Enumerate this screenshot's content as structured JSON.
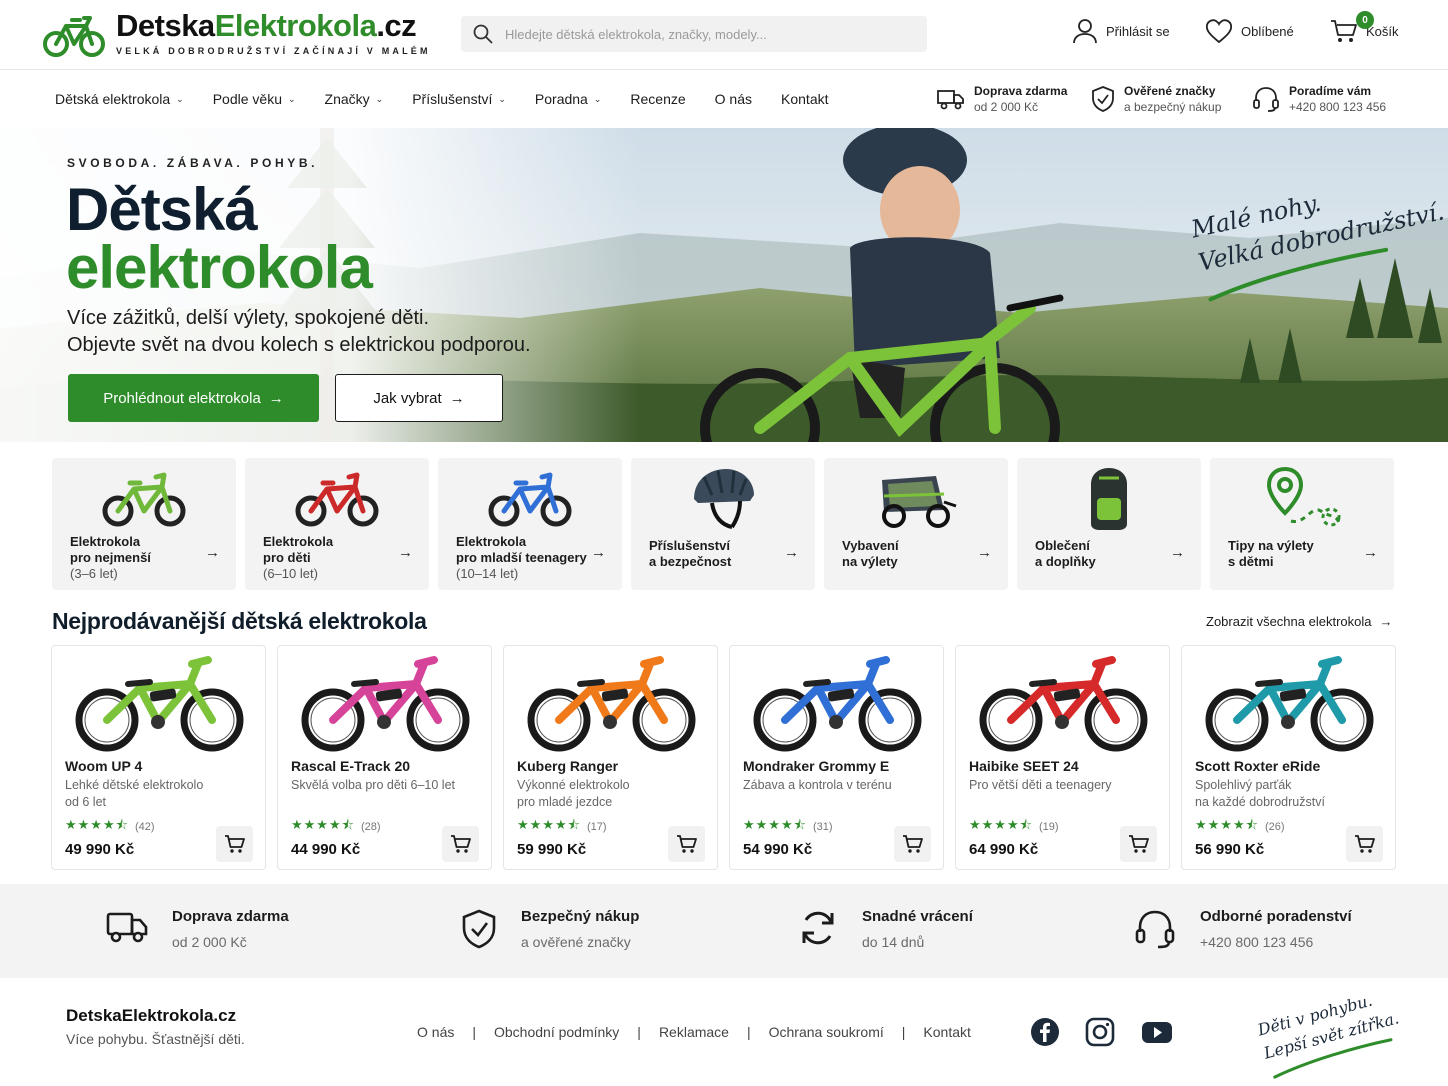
{
  "header": {
    "brand_part1": "Detska",
    "brand_part2": "Elektrokola",
    "brand_part3": ".cz",
    "tagline": "VELKÁ DOBRODRUŽSTVÍ ZAČÍNAJÍ V MALÉM",
    "search_placeholder": "Hledejte dětská elektrokola, značky, modely...",
    "login": "Přihlásit se",
    "favorites": "Oblíbené",
    "cart": "Košík",
    "cart_count": "0"
  },
  "nav": {
    "items": [
      {
        "label": "Dětská elektrokola",
        "dropdown": true
      },
      {
        "label": "Podle věku",
        "dropdown": true
      },
      {
        "label": "Značky",
        "dropdown": true
      },
      {
        "label": "Příslušenství",
        "dropdown": true
      },
      {
        "label": "Poradna",
        "dropdown": true
      },
      {
        "label": "Recenze",
        "dropdown": false
      },
      {
        "label": "O nás",
        "dropdown": false
      },
      {
        "label": "Kontakt",
        "dropdown": false
      }
    ],
    "usps": [
      {
        "title": "Doprava zdarma",
        "text": "od 2 000 Kč",
        "icon": "truck-icon"
      },
      {
        "title": "Ověřené značky",
        "text": "a bezpečný nákup",
        "icon": "shield-check-icon"
      },
      {
        "title": "Poradíme vám",
        "text": "+420 800 123 456",
        "icon": "headset-icon"
      }
    ]
  },
  "hero": {
    "eyebrow": "SVOBODA. ZÁBAVA. POHYB.",
    "title_line1": "Dětská",
    "title_line2": "elektrokola",
    "subtitle_line1": "Více zážitků, delší výlety, spokojené děti.",
    "subtitle_line2": "Objevte svět na dvou kolech s elektrickou podporou.",
    "cta_primary": "Prohlédnout elektrokola",
    "cta_secondary": "Jak vybrat",
    "script_line1": "Malé nohy.",
    "script_line2": "Velká dobrodružství."
  },
  "categories": [
    {
      "line1": "Elektrokola",
      "line2": "pro nejmenší",
      "line3": "(3–6 let)",
      "icon": "bike-green"
    },
    {
      "line1": "Elektrokola",
      "line2": "pro děti",
      "line3": "(6–10 let)",
      "icon": "bike-red"
    },
    {
      "line1": "Elektrokola",
      "line2": "pro mladší teenagery",
      "line3": "(10–14 let)",
      "icon": "bike-blue"
    },
    {
      "line1": "Příslušenství",
      "line2": "a bezpečnost",
      "line3": "",
      "icon": "helmet"
    },
    {
      "line1": "Vybavení",
      "line2": "na výlety",
      "line3": "",
      "icon": "trailer"
    },
    {
      "line1": "Oblečení",
      "line2": "a doplňky",
      "line3": "",
      "icon": "backpack"
    },
    {
      "line1": "Tipy na výlety",
      "line2": "s dětmi",
      "line3": "",
      "icon": "map-pin"
    }
  ],
  "bestsellers": {
    "title": "Nejprodávanější dětská elektrokola",
    "show_all": "Zobrazit všechna elektrokola",
    "products": [
      {
        "name": "Woom UP 4",
        "desc1": "Lehké dětské elektrokolo",
        "desc2": "od 6 let",
        "rating": 4.5,
        "reviews": "(42)",
        "price": "49 990 Kč",
        "color": "#7cc33a"
      },
      {
        "name": "Rascal E-Track 20",
        "desc1": "Skvělá volba pro děti 6–10 let",
        "desc2": "",
        "rating": 4.5,
        "reviews": "(28)",
        "price": "44 990 Kč",
        "color": "#d6449a"
      },
      {
        "name": "Kuberg Ranger",
        "desc1": "Výkonné elektrokolo",
        "desc2": "pro mladé jezdce",
        "rating": 4.5,
        "reviews": "(17)",
        "price": "59 990 Kč",
        "color": "#f07a1a"
      },
      {
        "name": "Mondraker Grommy E",
        "desc1": "Zábava a kontrola v terénu",
        "desc2": "",
        "rating": 4.5,
        "reviews": "(31)",
        "price": "54 990 Kč",
        "color": "#2f6fd6"
      },
      {
        "name": "Haibike SEET 24",
        "desc1": "Pro větší děti a teenagery",
        "desc2": "",
        "rating": 4.5,
        "reviews": "(19)",
        "price": "64 990 Kč",
        "color": "#d62a2a"
      },
      {
        "name": "Scott Roxter eRide",
        "desc1": "Spolehlivý parťák",
        "desc2": "na každé dobrodružství",
        "rating": 4.5,
        "reviews": "(26)",
        "price": "56 990 Kč",
        "color": "#1f9aa8"
      }
    ]
  },
  "benefits": [
    {
      "title": "Doprava zdarma",
      "text": "od 2 000 Kč",
      "icon": "truck-icon"
    },
    {
      "title": "Bezpečný nákup",
      "text": "a ověřené značky",
      "icon": "shield-check-icon"
    },
    {
      "title": "Snadné vrácení",
      "text": "do 14 dnů",
      "icon": "return-icon"
    },
    {
      "title": "Odborné poradenství",
      "text": "+420 800 123 456",
      "icon": "headset-icon"
    }
  ],
  "footer": {
    "brand": "DetskaElektrokola.cz",
    "slogan": "Více pohybu. Šťastnější děti.",
    "links": [
      "O nás",
      "Obchodní podmínky",
      "Reklamace",
      "Ochrana soukromí",
      "Kontakt"
    ],
    "social": [
      "facebook-icon",
      "instagram-icon",
      "youtube-icon"
    ],
    "script_line1": "Děti v pohybu.",
    "script_line2": "Lepší svět zítřka."
  },
  "colors": {
    "accent": "#2e8c2a",
    "dark": "#0f1f2f",
    "panel": "#f3f3f3"
  }
}
